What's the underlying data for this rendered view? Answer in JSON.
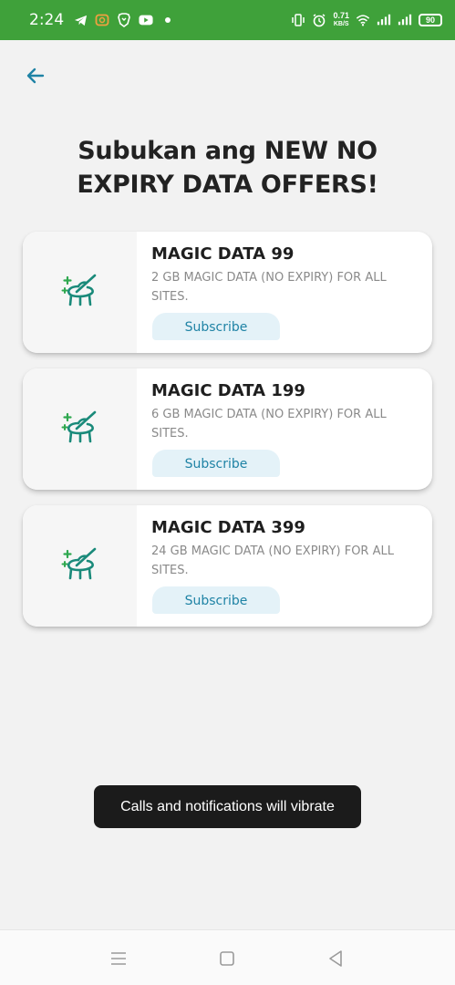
{
  "status_bar": {
    "time": "2:24",
    "net_speed_value": "0.71",
    "net_speed_unit": "KB/S",
    "battery": "90",
    "icons_left": [
      "telegram-icon",
      "app-notification-icon",
      "brave-icon",
      "youtube-icon",
      "dot-icon"
    ],
    "icons_right": [
      "vibrate-icon",
      "alarm-icon",
      "wifi-icon",
      "signal-icon",
      "signal-icon",
      "battery-icon"
    ]
  },
  "header": {
    "back_icon": "arrow-left-icon",
    "title": "Subukan ang NEW NO EXPIRY DATA OFFERS!"
  },
  "offers": [
    {
      "name": "MAGIC DATA 99",
      "description": "2 GB MAGIC DATA (NO EXPIRY) FOR ALL SITES.",
      "button_label": "Subscribe",
      "icon": "magic-hat-icon"
    },
    {
      "name": "MAGIC DATA 199",
      "description": "6 GB MAGIC DATA (NO EXPIRY) FOR ALL SITES.",
      "button_label": "Subscribe",
      "icon": "magic-hat-icon"
    },
    {
      "name": "MAGIC DATA 399",
      "description": "24 GB MAGIC DATA (NO EXPIRY) FOR ALL SITES.",
      "button_label": "Subscribe",
      "icon": "magic-hat-icon"
    }
  ],
  "toast": {
    "message": "Calls and notifications will vibrate"
  },
  "nav_bar": {
    "icons": [
      "menu-icon",
      "home-square-icon",
      "back-triangle-icon"
    ]
  },
  "colors": {
    "status_bar": "#3fa13a",
    "accent": "#1f83a5",
    "icon_teal": "#1a8a7a",
    "icon_green": "#2fa84f",
    "button_bg": "#e4f2f8",
    "background": "#f2f2f2"
  }
}
